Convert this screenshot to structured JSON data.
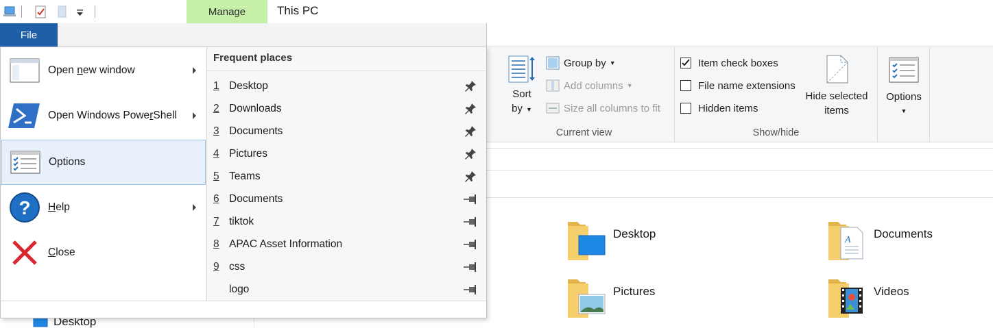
{
  "title_bar": {
    "manage_tab": "Manage",
    "window_title": "This PC"
  },
  "file_tab": {
    "label": "File"
  },
  "file_menu": {
    "items": [
      {
        "pre": "Open ",
        "key": "n",
        "post": "ew window",
        "icon": "window-icon",
        "has_submenu": true
      },
      {
        "pre": "Open Windows Powe",
        "key": "r",
        "post": "Shell",
        "icon": "powershell-icon",
        "has_submenu": true
      },
      {
        "pre": "",
        "key": "",
        "post": "Options",
        "icon": "options-icon",
        "has_submenu": false,
        "highlighted": true
      },
      {
        "pre": "",
        "key": "H",
        "post": "elp",
        "icon": "help-icon",
        "has_submenu": true
      },
      {
        "pre": "",
        "key": "C",
        "post": "lose",
        "icon": "close-icon",
        "has_submenu": false
      }
    ],
    "frequent_places": {
      "title": "Frequent places",
      "items": [
        {
          "num": "1",
          "name": "Desktop",
          "pinned": true
        },
        {
          "num": "2",
          "name": "Downloads",
          "pinned": true
        },
        {
          "num": "3",
          "name": "Documents",
          "pinned": true
        },
        {
          "num": "4",
          "name": "Pictures",
          "pinned": true
        },
        {
          "num": "5",
          "name": "Teams",
          "pinned": true
        },
        {
          "num": "6",
          "name": "Documents",
          "pinned": false
        },
        {
          "num": "7",
          "name": "tiktok",
          "pinned": false
        },
        {
          "num": "8",
          "name": "APAC Asset Information",
          "pinned": false
        },
        {
          "num": "9",
          "name": "css",
          "pinned": false
        },
        {
          "num": "",
          "name": "logo",
          "pinned": false
        }
      ]
    }
  },
  "ribbon": {
    "sort_by": {
      "line1": "Sort",
      "line2": "by"
    },
    "group_by": "Group by",
    "add_columns": "Add columns",
    "size_all_columns": "Size all columns to fit",
    "current_view_label": "Current view",
    "item_check_boxes": {
      "label": "Item check boxes",
      "checked": true
    },
    "file_name_extensions": {
      "label": "File name extensions",
      "checked": false
    },
    "hidden_items": {
      "label": "Hidden items",
      "checked": false
    },
    "hide_selected": {
      "line1": "Hide selected",
      "line2": "items"
    },
    "show_hide_label": "Show/hide",
    "options": "Options"
  },
  "content": {
    "folders": [
      {
        "name": "Desktop",
        "icon": "desktop-folder-icon"
      },
      {
        "name": "Documents",
        "icon": "documents-folder-icon"
      },
      {
        "name": "Pictures",
        "icon": "pictures-folder-icon"
      },
      {
        "name": "Videos",
        "icon": "videos-folder-icon"
      }
    ],
    "nav_desktop": "Desktop"
  },
  "colors": {
    "file_tab": "#1e5fa8",
    "manage_tab": "#c6efa8",
    "highlight": "#e8f1fb",
    "folder": "#f4cf6b"
  }
}
